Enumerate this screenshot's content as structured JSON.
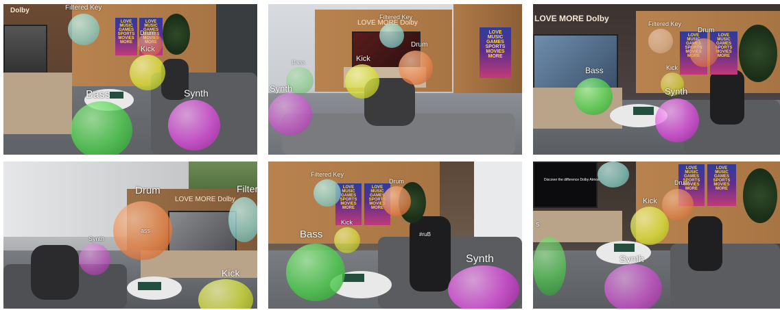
{
  "panels": [
    {
      "id": "panel-1",
      "labels": {
        "filtered_key": "Filtered Key",
        "drum": "Drum",
        "kick": "Kick",
        "bass": "Bass",
        "synth": "Synth"
      },
      "wall_logo": "Dolby",
      "poster": {
        "lines": [
          "LOVE",
          "MUSIC",
          "GAMES",
          "SPORTS",
          "MOVIES",
          "MORE"
        ]
      }
    },
    {
      "id": "panel-2",
      "labels": {
        "filtered_key": "Filtered Key",
        "drum": "Drum",
        "kick": "Kick",
        "bass": "Bass",
        "synth": "Synth"
      },
      "wall_logo": "LOVE MORE",
      "wall_logo_brand": "Dolby",
      "poster": {
        "lines": [
          "LOVE",
          "MUSIC",
          "GAMES",
          "SPORTS",
          "MOVIES",
          "MORE"
        ]
      }
    },
    {
      "id": "panel-3",
      "labels": {
        "filtered_key": "Filtered Key",
        "drum": "Drum",
        "kick": "Kick",
        "bass": "Bass",
        "synth": "Synth"
      },
      "wall_logo": "LOVE MORE",
      "wall_logo_brand": "Dolby",
      "poster": {
        "lines": [
          "LOVE",
          "MUSIC",
          "GAMES",
          "SPORTS",
          "MOVIES",
          "MORE"
        ]
      }
    },
    {
      "id": "panel-4",
      "labels": {
        "filter": "Filter",
        "drum": "Drum",
        "synth": "Synth",
        "bass": "ass",
        "kick": "Kick"
      },
      "wall_logo": "LOVE MORE",
      "wall_logo_brand": "Dolby"
    },
    {
      "id": "panel-5",
      "labels": {
        "filtered_key": "Filtered Key",
        "drum": "Drum",
        "kick": "Kick",
        "bass": "Bass",
        "synth": "Synth"
      },
      "shirt": "#ruB",
      "poster": {
        "lines": [
          "LOVE",
          "MUSIC",
          "GAMES",
          "SPORTS",
          "MOVIES",
          "MORE"
        ]
      }
    },
    {
      "id": "panel-6",
      "labels": {
        "drum": "Drum",
        "kick": "Kick",
        "synth": "Synth",
        "bass_partial": "s"
      },
      "tv_text": "Discover the difference",
      "tv_text_brand": "Dolby Atmos",
      "poster": {
        "lines": [
          "LOVE",
          "MUSIC",
          "GAMES",
          "SPORTS",
          "MOVIES",
          "MORE"
        ]
      }
    }
  ],
  "colors": {
    "filtered_key": "#8fd0c8",
    "drum": "#e8834a",
    "kick": "#d7e23a",
    "bass": "#4cd04c",
    "synth": "#e04fe0",
    "wood": "#a77a50",
    "floor": "#5a5f66"
  }
}
